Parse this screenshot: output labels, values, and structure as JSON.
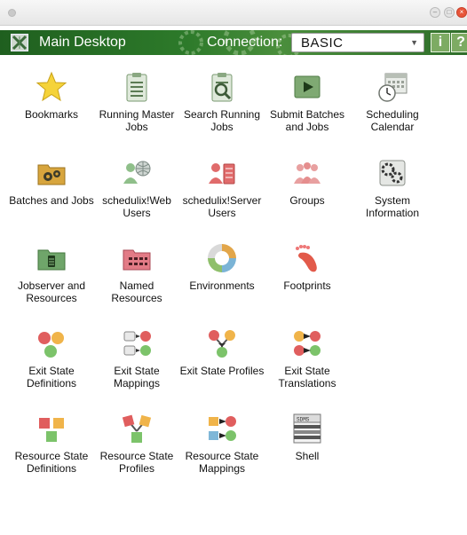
{
  "window": {
    "min_symbol": "–",
    "max_symbol": "□",
    "close_symbol": "×"
  },
  "header": {
    "title": "Main Desktop",
    "connection_label": "Connection:",
    "connection_value": "BASIC",
    "info_button": "i",
    "help_button": "?"
  },
  "items": [
    {
      "label": "Bookmarks",
      "icon": "star-icon"
    },
    {
      "label": "Running Master Jobs",
      "icon": "clipboard-list-icon"
    },
    {
      "label": "Search Running Jobs",
      "icon": "clipboard-search-icon"
    },
    {
      "label": "Submit Batches and Jobs",
      "icon": "play-icon"
    },
    {
      "label": "Scheduling Calendar",
      "icon": "calendar-clock-icon"
    },
    {
      "label": "Batches and Jobs",
      "icon": "folder-gears-icon"
    },
    {
      "label": "schedulix!Web Users",
      "icon": "web-users-icon"
    },
    {
      "label": "schedulix!Server Users",
      "icon": "server-users-icon"
    },
    {
      "label": "Groups",
      "icon": "groups-icon"
    },
    {
      "label": "System Information",
      "icon": "system-gears-icon"
    },
    {
      "label": "Jobserver and Resources",
      "icon": "folder-server-icon"
    },
    {
      "label": "Named Resources",
      "icon": "folder-grid-icon"
    },
    {
      "label": "Environments",
      "icon": "environments-ring-icon"
    },
    {
      "label": "Footprints",
      "icon": "footprint-icon"
    },
    {
      "label": "Exit State Definitions",
      "icon": "exit-state-definitions-icon"
    },
    {
      "label": "Exit State Mappings",
      "icon": "exit-state-mappings-icon"
    },
    {
      "label": "Exit State Profiles",
      "icon": "exit-state-profiles-icon"
    },
    {
      "label": "Exit State Translations",
      "icon": "exit-state-translations-icon"
    },
    {
      "label": "Resource State Definitions",
      "icon": "resource-state-definitions-icon"
    },
    {
      "label": "Resource State Profiles",
      "icon": "resource-state-profiles-icon"
    },
    {
      "label": "Resource State Mappings",
      "icon": "resource-state-mappings-icon"
    },
    {
      "label": "Shell",
      "icon": "shell-icon"
    }
  ],
  "shell_icon_text": "SDMS"
}
